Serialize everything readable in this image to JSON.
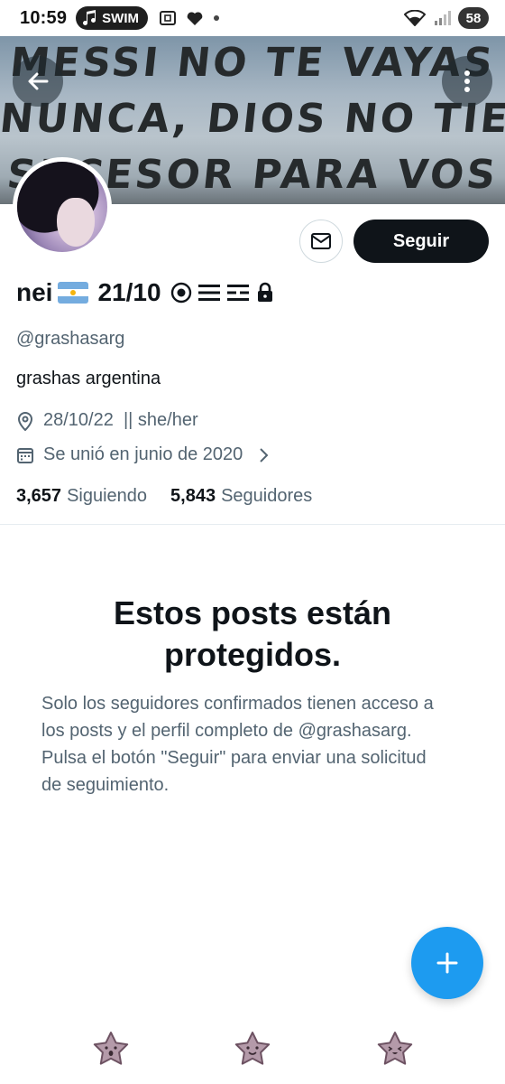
{
  "status_bar": {
    "time": "10:59",
    "media_label": "SWIM",
    "battery": "58",
    "icons": [
      "music-note-icon",
      "screenshot-icon",
      "heart-icon",
      "dot-icon",
      "wifi-icon",
      "signal-icon"
    ]
  },
  "banner": {
    "lines": [
      "MESSI NO TE VAYAS",
      "NUNCA, DIOS NO TIENE",
      "SUCESOR PARA VOS"
    ]
  },
  "profile": {
    "name": "nei",
    "name_after_flag": "21/10",
    "handle": "@grashasarg",
    "bio": "grashas argentina",
    "location": "28/10/22  || she/her",
    "joined": "Se unió en junio de 2020",
    "following_count": "3,657",
    "following_label": "Siguiendo",
    "followers_count": "5,843",
    "followers_label": "Seguidores"
  },
  "actions": {
    "follow_label": "Seguir"
  },
  "protected": {
    "title": "Estos posts están protegidos.",
    "text": "Solo los seguidores confirmados tienen acceso a los posts y el perfil completo de @grashasarg. Pulsa el botón \"Seguir\" para enviar una solicitud de seguimiento."
  },
  "colors": {
    "accent": "#1d9bf0",
    "text_primary": "#0f1419",
    "text_secondary": "#536471",
    "follow_button": "#0f1419",
    "sticker": "#b49aa9"
  }
}
